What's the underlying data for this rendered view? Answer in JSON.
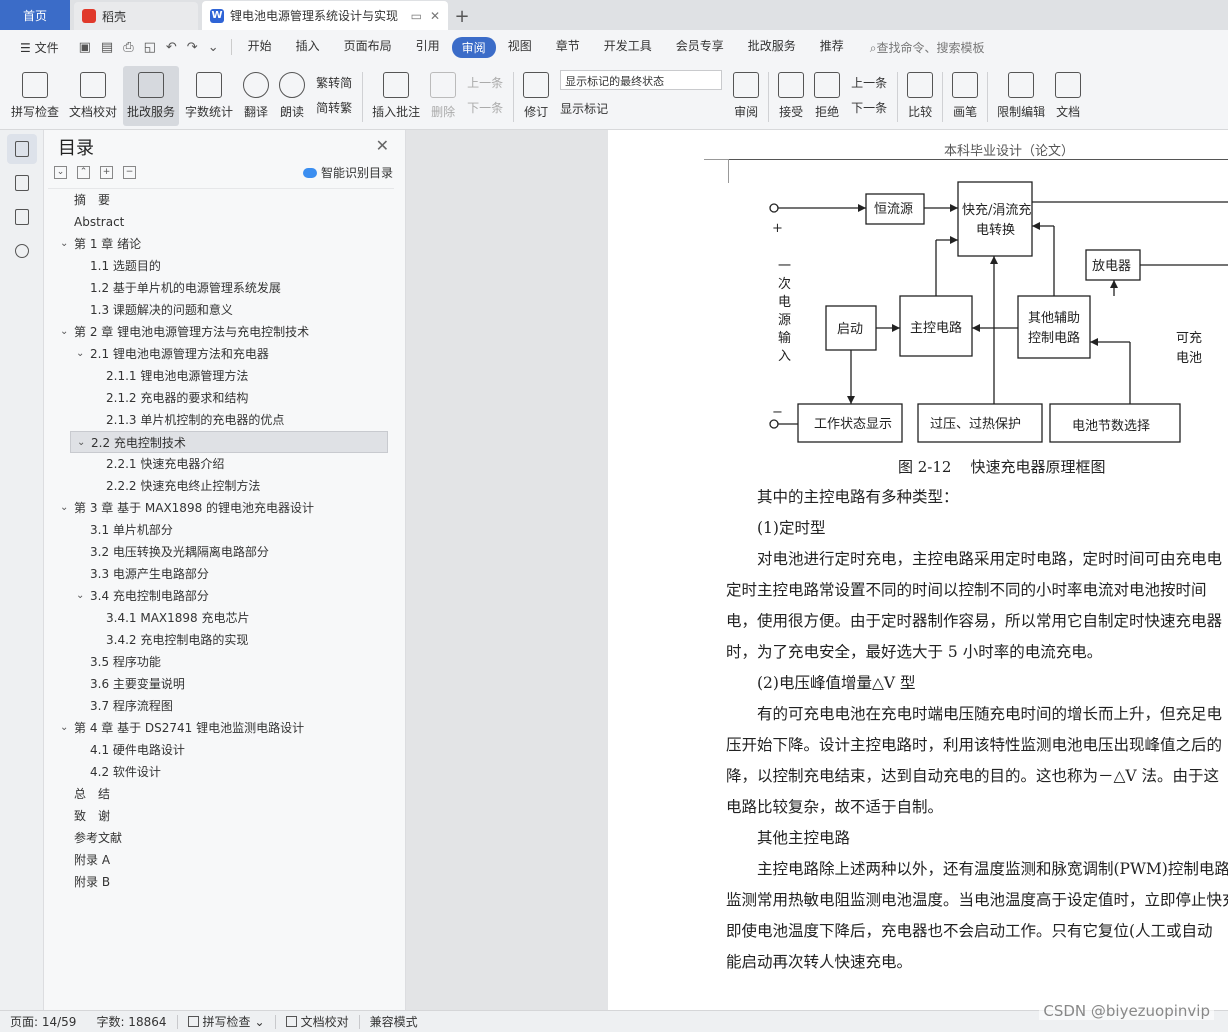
{
  "tabs": {
    "home": "首页",
    "docer": "稻壳",
    "document": "锂电池电源管理系统设计与实现"
  },
  "menu": {
    "file": "文件",
    "items": [
      "开始",
      "插入",
      "页面布局",
      "引用",
      "审阅",
      "视图",
      "章节",
      "开发工具",
      "会员专享",
      "批改服务",
      "推荐"
    ],
    "active_index": 4,
    "search": "查找命令、搜索模板"
  },
  "ribbon": {
    "spellcheck": "拼写检查",
    "doccheck": "文档校对",
    "correction": "批改服务",
    "wordcount": "字数统计",
    "translate": "翻译",
    "read": "朗读",
    "to_traditional": "繁转简",
    "to_simplified": "简转繁",
    "insert_comment": "插入批注",
    "delete": "删除",
    "prev": "上一条",
    "next": "下一条",
    "revise": "修订",
    "markup_state": "显示标记的最终状态",
    "show_markup": "显示标记",
    "review": "审阅",
    "accept": "接受",
    "reject": "拒绝",
    "prev2": "上一条",
    "next2": "下一条",
    "compare": "比较",
    "pen": "画笔",
    "restrict": "限制编辑",
    "doc_more": "文档"
  },
  "toc": {
    "title": "目录",
    "smart": "智能识别目录",
    "items": [
      {
        "text": "摘　要",
        "indent": 1,
        "chev": ""
      },
      {
        "text": "Abstract",
        "indent": 1,
        "chev": ""
      },
      {
        "text": "第 1 章  绪论",
        "indent": 1,
        "chev": "v"
      },
      {
        "text": "1.1  选题目的",
        "indent": 2,
        "chev": ""
      },
      {
        "text": "1.2  基于单片机的电源管理系统发展",
        "indent": 2,
        "chev": ""
      },
      {
        "text": "1.3  课题解决的问题和意义",
        "indent": 2,
        "chev": ""
      },
      {
        "text": "第 2 章  锂电池电源管理方法与充电控制技术",
        "indent": 1,
        "chev": "v"
      },
      {
        "text": "2.1  锂电池电源管理方法和充电器",
        "indent": 2,
        "chev": "v"
      },
      {
        "text": "2.1.1 锂电池电源管理方法",
        "indent": 3,
        "chev": ""
      },
      {
        "text": "2.1.2 充电器的要求和结构",
        "indent": 3,
        "chev": ""
      },
      {
        "text": "2.1.3 单片机控制的充电器的优点",
        "indent": 3,
        "chev": ""
      },
      {
        "text": "2.2  充电控制技术",
        "indent": 2,
        "chev": "v",
        "selected": true
      },
      {
        "text": "2.2.1  快速充电器介绍",
        "indent": 3,
        "chev": ""
      },
      {
        "text": "2.2.2  快速充电终止控制方法",
        "indent": 3,
        "chev": ""
      },
      {
        "text": " 第 3 章  基于 MAX1898 的锂电池充电器设计",
        "indent": 1,
        "chev": "v"
      },
      {
        "text": "3.1  单片机部分",
        "indent": 2,
        "chev": ""
      },
      {
        "text": "3.2  电压转换及光耦隔离电路部分",
        "indent": 2,
        "chev": ""
      },
      {
        "text": "3.3  电源产生电路部分",
        "indent": 2,
        "chev": ""
      },
      {
        "text": "3.4  充电控制电路部分",
        "indent": 2,
        "chev": "v"
      },
      {
        "text": "3.4.1 MAX1898 充电芯片",
        "indent": 3,
        "chev": ""
      },
      {
        "text": "3.4.2 充电控制电路的实现",
        "indent": 3,
        "chev": ""
      },
      {
        "text": "3.5  程序功能",
        "indent": 2,
        "chev": ""
      },
      {
        "text": "3.6  主要变量说明",
        "indent": 2,
        "chev": ""
      },
      {
        "text": "3.7  程序流程图",
        "indent": 2,
        "chev": ""
      },
      {
        "text": "第 4 章  基于 DS2741 锂电池监测电路设计",
        "indent": 1,
        "chev": "v"
      },
      {
        "text": "4.1  硬件电路设计",
        "indent": 2,
        "chev": ""
      },
      {
        "text": "4.2  软件设计",
        "indent": 2,
        "chev": ""
      },
      {
        "text": "总　结",
        "indent": 1,
        "chev": ""
      },
      {
        "text": "致　谢",
        "indent": 1,
        "chev": ""
      },
      {
        "text": "参考文献",
        "indent": 1,
        "chev": ""
      },
      {
        "text": "附录 A",
        "indent": 1,
        "chev": ""
      },
      {
        "text": "附录 B",
        "indent": 1,
        "chev": ""
      }
    ]
  },
  "document": {
    "header": "本科毕业设计（论文）",
    "diagram": {
      "plus": "+",
      "minus": "−",
      "input_label": [
        "一",
        "次",
        "电",
        "源",
        "输",
        "入"
      ],
      "constant_current": "恒流源",
      "fast_charge_1": "快充/涓流充",
      "fast_charge_2": "电转换",
      "discharger": "放电器",
      "start": "启动",
      "main_control": "主控电路",
      "aux_1": "其他辅助",
      "aux_2": "控制电路",
      "rechargeable_1": "可充",
      "rechargeable_2": "电池",
      "battery_plus": "+",
      "status_display": "工作状态显示",
      "protection": "过压、过热保护",
      "cell_select": "电池节数选择"
    },
    "caption": "图 2-12    快速充电器原理框图",
    "paragraphs": [
      "　　其中的主控电路有多种类型：",
      "　　(1)定时型",
      "　　对电池进行定时充电，主控电路采用定时电路，定时时间可由充电电",
      "定时主控电路常设置不同的时间以控制不同的小时率电流对电池按时间",
      "电，使用很方便。由于定时器制作容易，所以常用它自制定时快速充电器",
      "时，为了充电安全，最好选大于 5 小时率的电流充电。",
      "　　(2)电压峰值增量△V 型",
      "　　有的可充电电池在充电时端电压随充电时间的增长而上升，但充足电",
      "压开始下降。设计主控电路时，利用该特性监测电池电压出现峰值之后的",
      "降，以控制充电结束，达到自动充电的目的。这也称为－△V 法。由于这",
      "电路比较复杂，故不适于自制。",
      "　　其他主控电路",
      "　　主控电路除上述两种以外，还有温度监测和脉宽调制(PWM)控制电路",
      "监测常用热敏电阻监测电池温度。当电池温度高于设定值时，立即停止快充",
      "即使电池温度下降后，充电器也不会启动工作。只有它复位(人工或自动",
      "能启动再次转人快速充电。"
    ]
  },
  "status": {
    "page": "页面: 14/59",
    "words": "字数: 18864",
    "spell": "拼写检查",
    "doccheck": "文档校对",
    "compat": "兼容模式"
  },
  "watermark": "CSDN @biyezuopinvip"
}
